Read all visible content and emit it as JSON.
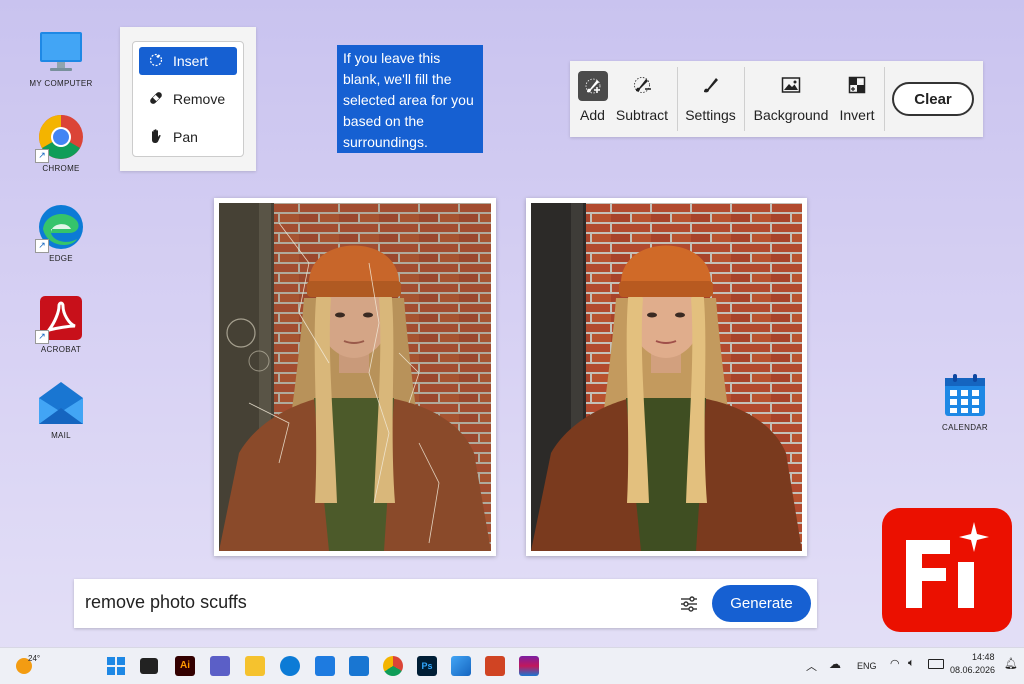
{
  "desktop": {
    "icons": [
      {
        "label": "MY COMPUTER"
      },
      {
        "label": "CHROME"
      },
      {
        "label": "EDGE"
      },
      {
        "label": "ACROBAT"
      },
      {
        "label": "MAIL"
      },
      {
        "label": "CALENDAR"
      }
    ]
  },
  "tools": {
    "items": [
      {
        "label": "Insert",
        "icon": "lasso-plus-icon",
        "active": true
      },
      {
        "label": "Remove",
        "icon": "bandage-icon",
        "active": false
      },
      {
        "label": "Pan",
        "icon": "hand-icon",
        "active": false
      }
    ]
  },
  "tooltip": {
    "text": "If you leave this blank, we'll fill the selected area for you based on the surroundings."
  },
  "toolbar": {
    "add_label": "Add",
    "subtract_label": "Subtract",
    "settings_label": "Settings",
    "background_label": "Background",
    "invert_label": "Invert",
    "clear_label": "Clear"
  },
  "prompt": {
    "value": "remove photo scuffs",
    "generate_label": "Generate"
  },
  "logo": {
    "text": "Fi"
  },
  "taskbar": {
    "weather_temp": "24°",
    "language": "ENG",
    "time": "14:48",
    "date": "08.06.2026"
  },
  "colors": {
    "accent": "#1660d2",
    "logo_red": "#eb1000",
    "desktop_bg": "#d6d0f3"
  }
}
